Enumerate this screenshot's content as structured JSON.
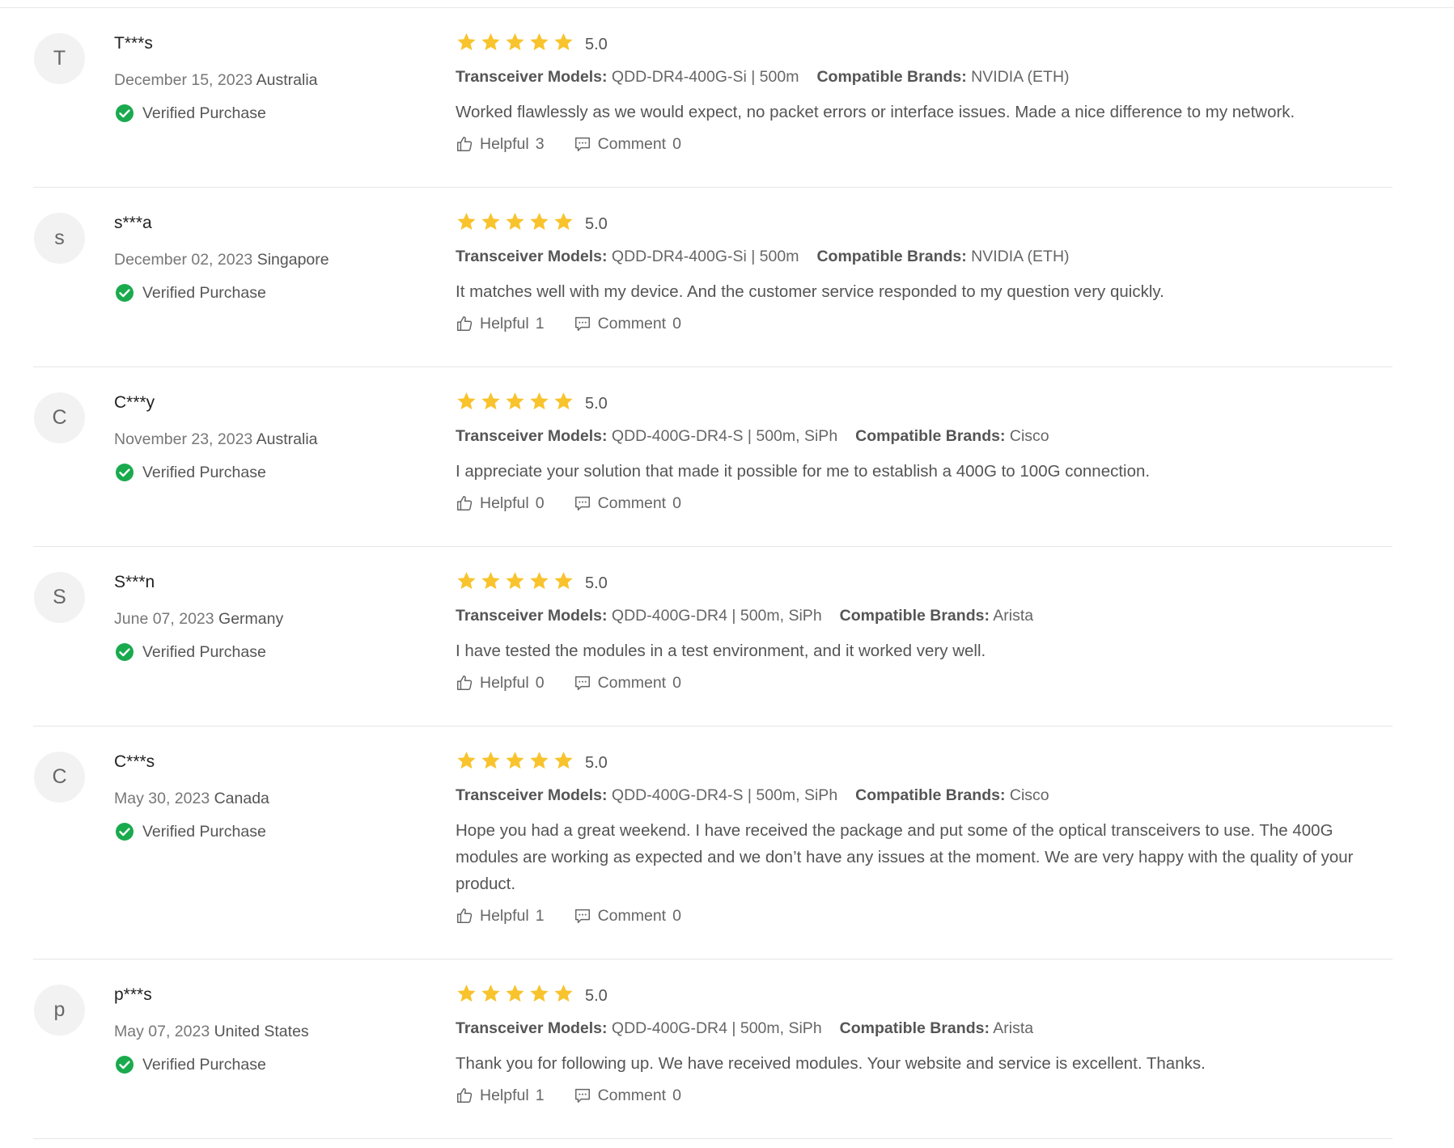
{
  "reviews": [
    {
      "avatar_letter": "T",
      "username": "T***s",
      "date": "December 15, 2023",
      "country": "Australia",
      "verified_label": "Verified Purchase",
      "stars": 5,
      "score": "5.0",
      "models_label": "Transceiver Models:",
      "models_value": "QDD-DR4-400G-Si | 500m",
      "brands_label": "Compatible Brands:",
      "brands_value": "NVIDIA (ETH)",
      "text": "Worked flawlessly as we would expect, no packet errors or interface issues. Made a nice difference to my network.",
      "helpful_label": "Helpful",
      "helpful_count": "3",
      "comment_label": "Comment",
      "comment_count": "0"
    },
    {
      "avatar_letter": "s",
      "username": "s***a",
      "date": "December 02, 2023",
      "country": "Singapore",
      "verified_label": "Verified Purchase",
      "stars": 5,
      "score": "5.0",
      "models_label": "Transceiver Models:",
      "models_value": "QDD-DR4-400G-Si | 500m",
      "brands_label": "Compatible Brands:",
      "brands_value": "NVIDIA (ETH)",
      "text": "It matches well with my device. And the customer service responded to my question very quickly.",
      "helpful_label": "Helpful",
      "helpful_count": "1",
      "comment_label": "Comment",
      "comment_count": "0"
    },
    {
      "avatar_letter": "C",
      "username": "C***y",
      "date": "November 23, 2023",
      "country": "Australia",
      "verified_label": "Verified Purchase",
      "stars": 5,
      "score": "5.0",
      "models_label": "Transceiver Models:",
      "models_value": "QDD-400G-DR4-S | 500m, SiPh",
      "brands_label": "Compatible Brands:",
      "brands_value": "Cisco",
      "text": "I appreciate your solution that made it possible for me to establish a 400G to 100G connection.",
      "helpful_label": "Helpful",
      "helpful_count": "0",
      "comment_label": "Comment",
      "comment_count": "0"
    },
    {
      "avatar_letter": "S",
      "username": "S***n",
      "date": "June 07, 2023",
      "country": "Germany",
      "verified_label": "Verified Purchase",
      "stars": 5,
      "score": "5.0",
      "models_label": "Transceiver Models:",
      "models_value": "QDD-400G-DR4 | 500m, SiPh",
      "brands_label": "Compatible Brands:",
      "brands_value": "Arista",
      "text": "I have tested the modules in a test environment, and it worked very well.",
      "helpful_label": "Helpful",
      "helpful_count": "0",
      "comment_label": "Comment",
      "comment_count": "0"
    },
    {
      "avatar_letter": "C",
      "username": "C***s",
      "date": "May 30, 2023",
      "country": "Canada",
      "verified_label": "Verified Purchase",
      "stars": 5,
      "score": "5.0",
      "models_label": "Transceiver Models:",
      "models_value": "QDD-400G-DR4-S | 500m, SiPh",
      "brands_label": "Compatible Brands:",
      "brands_value": "Cisco",
      "text": "Hope you had a great weekend. I have received the package and put some of the optical transceivers to use. The 400G modules are working as expected and we don’t have any issues at the moment. We are very happy with the quality of your product.",
      "helpful_label": "Helpful",
      "helpful_count": "1",
      "comment_label": "Comment",
      "comment_count": "0"
    },
    {
      "avatar_letter": "p",
      "username": "p***s",
      "date": "May 07, 2023",
      "country": "United States",
      "verified_label": "Verified Purchase",
      "stars": 5,
      "score": "5.0",
      "models_label": "Transceiver Models:",
      "models_value": "QDD-400G-DR4 | 500m, SiPh",
      "brands_label": "Compatible Brands:",
      "brands_value": "Arista",
      "text": "Thank you for following up. We have received modules. Your website and service is excellent. Thanks.",
      "helpful_label": "Helpful",
      "helpful_count": "1",
      "comment_label": "Comment",
      "comment_count": "0"
    }
  ],
  "colors": {
    "star": "#f8c32c",
    "verified": "#1aaa4e",
    "divider": "#e6e6e6",
    "avatar_bg": "#f2f2f2"
  },
  "icons": {
    "star": "star-icon",
    "verified": "check-circle-icon",
    "helpful": "thumbs-up-icon",
    "comment": "comment-icon"
  }
}
